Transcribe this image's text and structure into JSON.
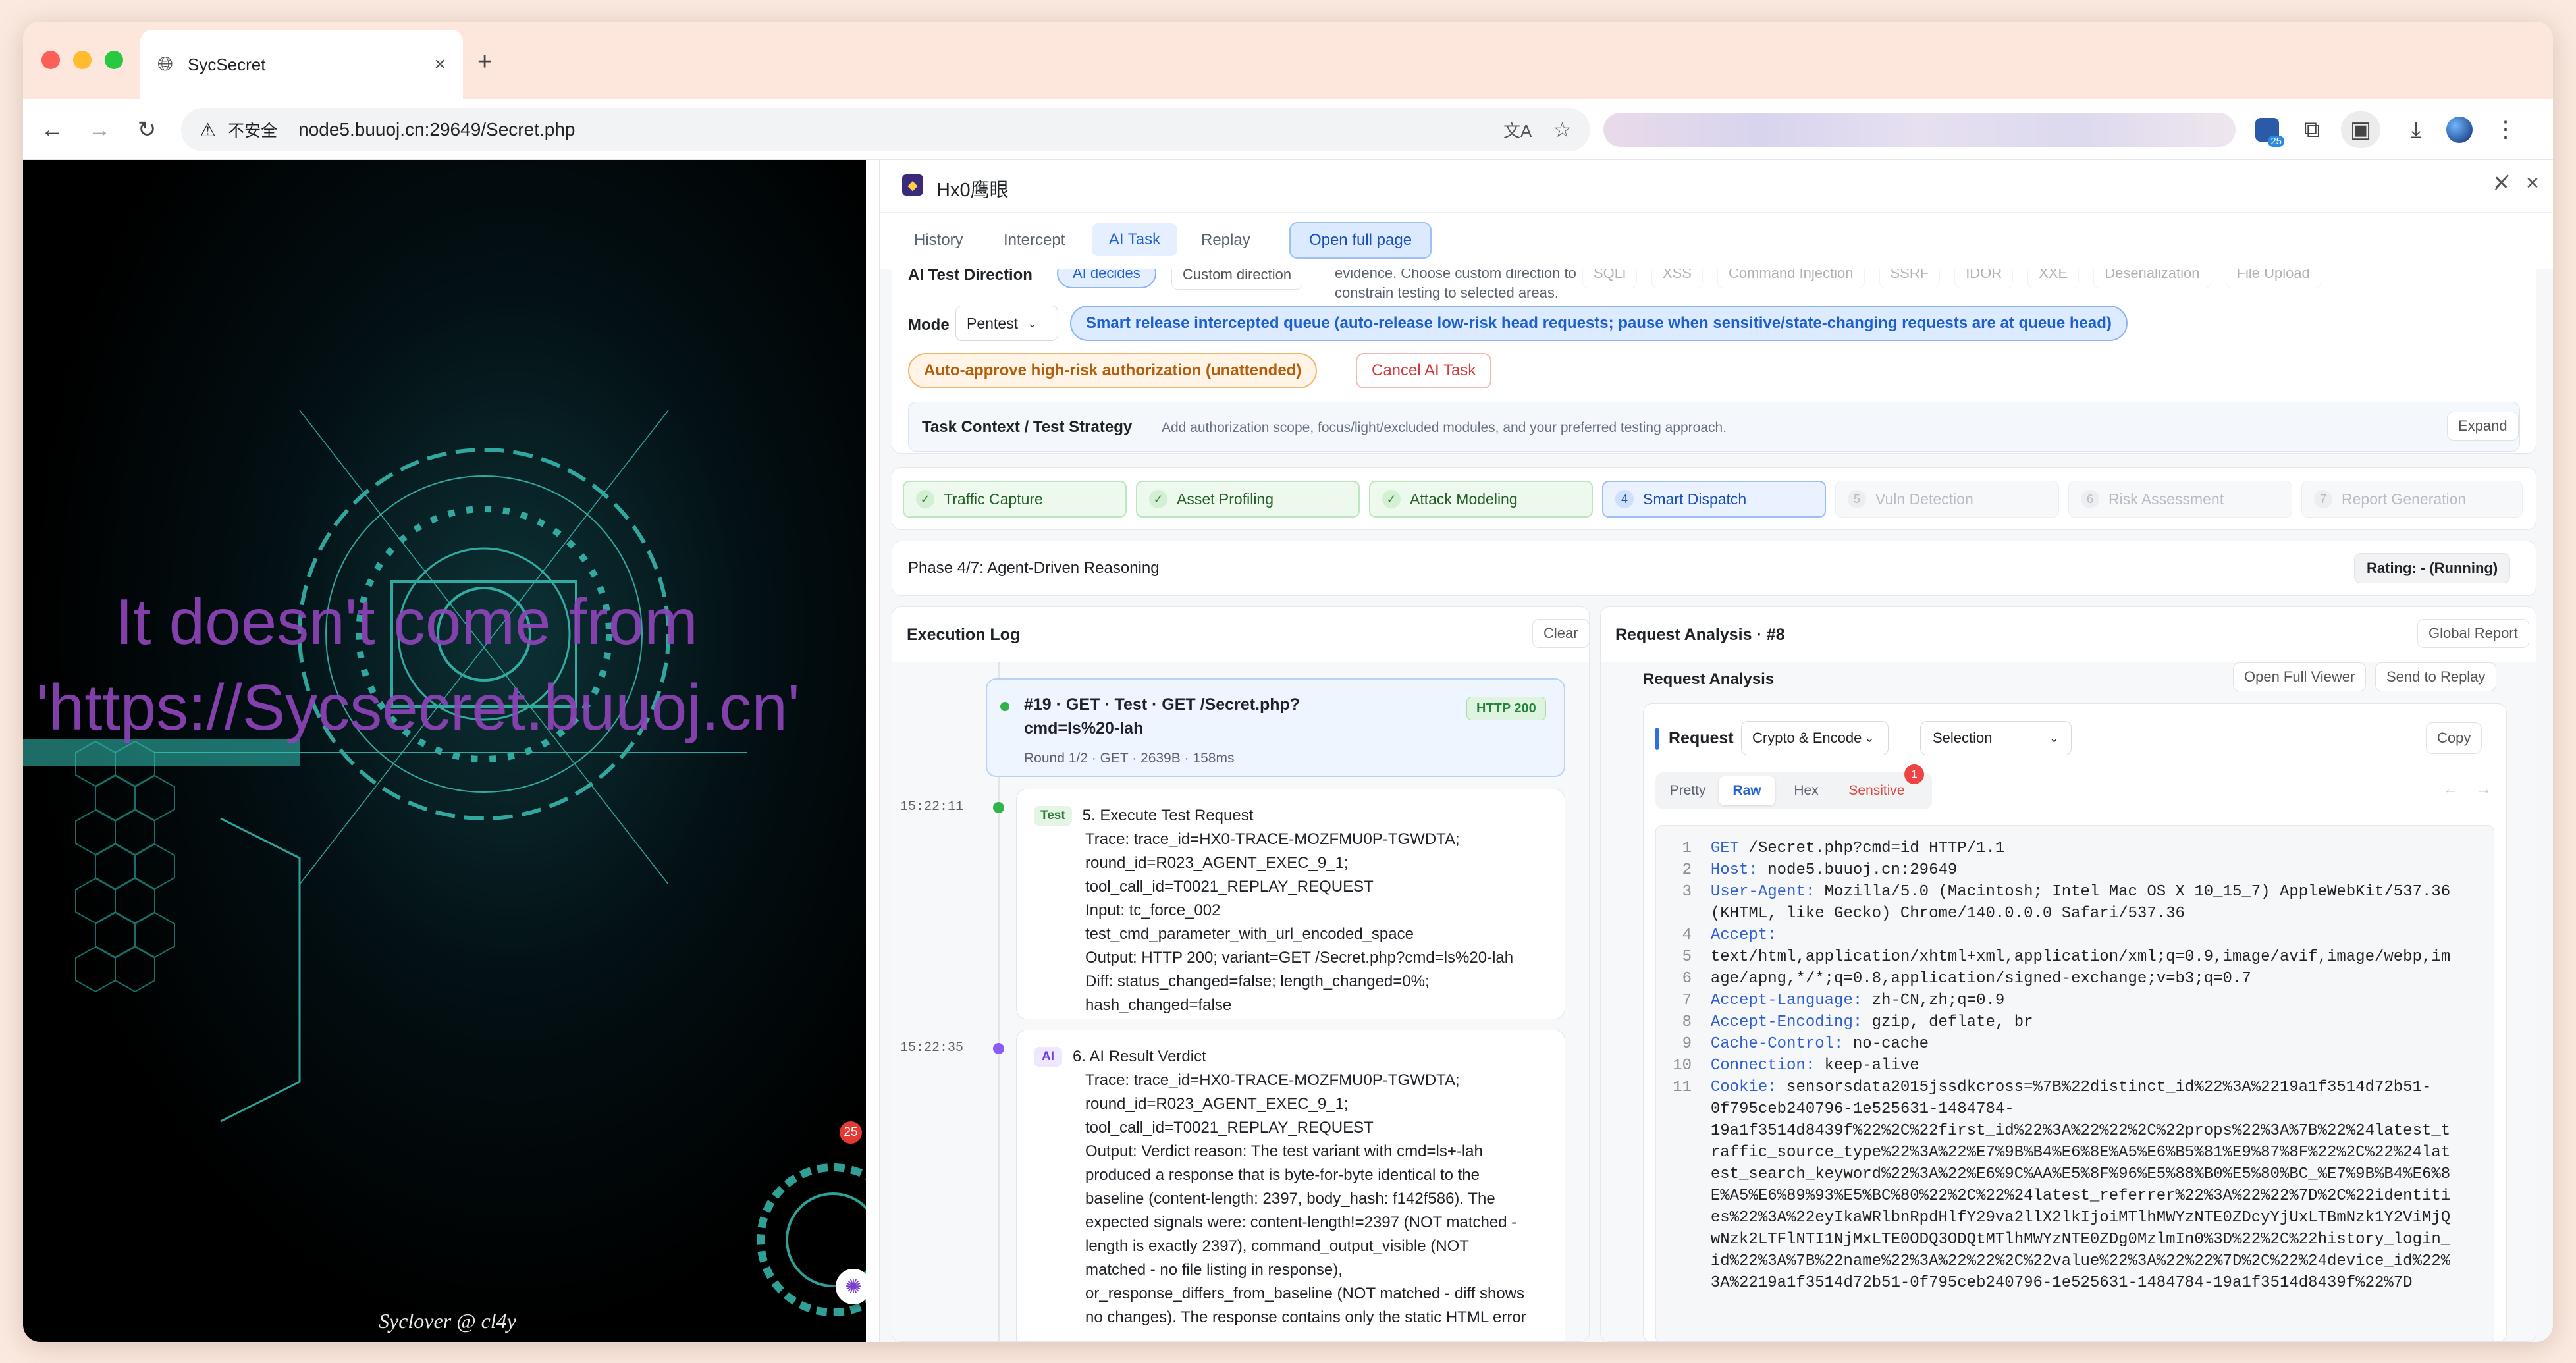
{
  "browser": {
    "tab_title": "SycSecret",
    "new_tab": "+",
    "security_label": "不安全",
    "url": "node5.buuoj.cn:29649/Secret.php",
    "ext_badge": "25"
  },
  "left": {
    "overlay_line1": "It doesn't come from",
    "overlay_line2": "'https://Sycsecret.buuoj.cn'",
    "signature": "Syclover @ cl4y",
    "badge": "25"
  },
  "panel": {
    "title": "Hx0鹰眼",
    "tabs": [
      "History",
      "Intercept",
      "AI Task",
      "Replay"
    ],
    "active_tab": "AI Task",
    "open_full_page": "Open full page",
    "direction": {
      "label": "AI Test Direction",
      "ai_decides": "AI decides",
      "custom": "Custom direction",
      "hint_line1": "evidence. Choose custom direction to",
      "hint_line2": "constrain testing to selected areas.",
      "chips": [
        "SQLi",
        "XSS",
        "Command Injection",
        "SSRF",
        "IDOR",
        "XXE",
        "Deserialization",
        "File Upload"
      ]
    },
    "mode": {
      "label": "Mode",
      "value": "Pentest",
      "smart_release": "Smart release intercepted queue (auto-release low-risk head requests; pause when sensitive/state-changing requests are at queue head)",
      "auto_approve": "Auto-approve high-risk authorization (unattended)",
      "cancel": "Cancel AI Task"
    },
    "context": {
      "label": "Task Context / Test Strategy",
      "placeholder": "Add authorization scope, focus/light/excluded modules, and your preferred testing approach.",
      "expand": "Expand"
    },
    "steps": [
      {
        "n": "✓",
        "label": "Traffic Capture",
        "state": "done"
      },
      {
        "n": "✓",
        "label": "Asset Profiling",
        "state": "done"
      },
      {
        "n": "✓",
        "label": "Attack Modeling",
        "state": "done"
      },
      {
        "n": "4",
        "label": "Smart Dispatch",
        "state": "cur"
      },
      {
        "n": "5",
        "label": "Vuln Detection",
        "state": "todo"
      },
      {
        "n": "6",
        "label": "Risk Assessment",
        "state": "todo"
      },
      {
        "n": "7",
        "label": "Report Generation",
        "state": "todo"
      }
    ],
    "phase": "Phase 4/7: Agent-Driven Reasoning",
    "rating": "Rating: - (Running)",
    "log": {
      "title": "Execution Log",
      "clear": "Clear",
      "req_card": {
        "line1": "#19 · GET · Test · GET /Secret.php?",
        "line2": "cmd=ls%20-lah",
        "status": "HTTP 200",
        "meta": "Round 1/2 · GET · 2639B · 158ms"
      },
      "entries": [
        {
          "time": "15:22:11",
          "tag": "Test",
          "title": "5. Execute Test Request",
          "lines": [
            "Trace: trace_id=HX0-TRACE-MOZFMU0P-TGWDTA;",
            "round_id=R023_AGENT_EXEC_9_1;",
            "tool_call_id=T0021_REPLAY_REQUEST",
            "Input: tc_force_002",
            "test_cmd_parameter_with_url_encoded_space",
            "Output: HTTP 200; variant=GET /Secret.php?cmd=ls%20-lah",
            "Diff: status_changed=false; length_changed=0%;",
            "hash_changed=false"
          ]
        },
        {
          "time": "15:22:35",
          "tag": "AI",
          "title": "6. AI Result Verdict",
          "lines": [
            "Trace: trace_id=HX0-TRACE-MOZFMU0P-TGWDTA;",
            "round_id=R023_AGENT_EXEC_9_1;",
            "tool_call_id=T0021_REPLAY_REQUEST",
            "Output: Verdict reason: The test variant with cmd=ls+-lah",
            "produced a response that is byte-for-byte identical to the",
            "baseline (content-length: 2397, body_hash: f142f586). The",
            "expected signals were: content-length!=2397 (NOT matched -",
            "length is exactly 2397), command_output_visible (NOT",
            "matched - no file listing in response),",
            "or_response_differs_from_baseline (NOT matched - diff shows",
            "no changes). The response contains only the static HTML error"
          ]
        }
      ]
    },
    "analysis": {
      "title": "Request Analysis · #8",
      "global_report": "Global Report",
      "sub_title": "Request Analysis",
      "open_full_viewer": "Open Full Viewer",
      "send_to_replay": "Send to Replay",
      "request_label": "Request",
      "crypto": "Crypto & Encode",
      "selection": "Selection",
      "copy": "Copy",
      "views": [
        "Pretty",
        "Raw",
        "Hex",
        "Sensitive"
      ],
      "active_view": "Raw",
      "sensitive_count": "1",
      "code": [
        {
          "n": "1",
          "k": "GET",
          "v": " /Secret.php?cmd=id HTTP/1.1"
        },
        {
          "n": "2",
          "k": "Host:",
          "v": " node5.buuoj.cn:29649"
        },
        {
          "n": "3",
          "k": "User-Agent:",
          "v": " Mozilla/5.0 (Macintosh; Intel Mac OS X 10_15_7) AppleWebKit/537.36"
        },
        {
          "n": "",
          "k": "",
          "v": "(KHTML, like Gecko) Chrome/140.0.0.0 Safari/537.36"
        },
        {
          "n": "4",
          "k": "Accept:",
          "v": ""
        },
        {
          "n": "5",
          "k": "",
          "v": "text/html,application/xhtml+xml,application/xml;q=0.9,image/avif,image/webp,im"
        },
        {
          "n": "6",
          "k": "",
          "v": "age/apng,*/*;q=0.8,application/signed-exchange;v=b3;q=0.7"
        },
        {
          "n": "7",
          "k": "Accept-Language:",
          "v": " zh-CN,zh;q=0.9"
        },
        {
          "n": "8",
          "k": "Accept-Encoding:",
          "v": " gzip, deflate, br"
        },
        {
          "n": "9",
          "k": "Cache-Control:",
          "v": " no-cache"
        },
        {
          "n": "10",
          "k": "Connection:",
          "v": " keep-alive"
        },
        {
          "n": "11",
          "k": "Cookie:",
          "v": " sensorsdata2015jssdkcross=%7B%22distinct_id%22%3A%2219a1f3514d72b51-"
        },
        {
          "n": "",
          "k": "",
          "v": "0f795ceb240796-1e525631-1484784-"
        },
        {
          "n": "",
          "k": "",
          "v": "19a1f3514d8439f%22%2C%22first_id%22%3A%22%22%2C%22props%22%3A%7B%22%24latest_t"
        },
        {
          "n": "",
          "k": "",
          "v": "raffic_source_type%22%3A%22%E7%9B%B4%E6%8E%A5%E6%B5%81%E9%87%8F%22%2C%22%24lat"
        },
        {
          "n": "",
          "k": "",
          "v": "est_search_keyword%22%3A%22%E6%9C%AA%E5%8F%96%E5%88%B0%E5%80%BC_%E7%9B%B4%E6%8"
        },
        {
          "n": "",
          "k": "",
          "v": "E%A5%E6%89%93%E5%BC%80%22%2C%22%24latest_referrer%22%3A%22%22%7D%2C%22identiti"
        },
        {
          "n": "",
          "k": "",
          "v": "es%22%3A%22eyIkaWRlbnRpdHlfY29va2llX2lkIjoiMTlhMWYzNTE0ZDcyYjUxLTBmNzk1Y2ViMjQ"
        },
        {
          "n": "",
          "k": "",
          "v": "wNzk2LTFlNTI1NjMxLTE0ODQ3ODQtMTlhMWYzNTE0ZDg0MzlmIn0%3D%22%2C%22history_login_"
        },
        {
          "n": "",
          "k": "",
          "v": "id%22%3A%7B%22name%22%3A%22%22%2C%22value%22%3A%22%22%7D%2C%22%24device_id%22%"
        },
        {
          "n": "",
          "k": "",
          "v": "3A%2219a1f3514d72b51-0f795ceb240796-1e525631-1484784-19a1f3514d8439f%22%7D"
        }
      ]
    }
  }
}
